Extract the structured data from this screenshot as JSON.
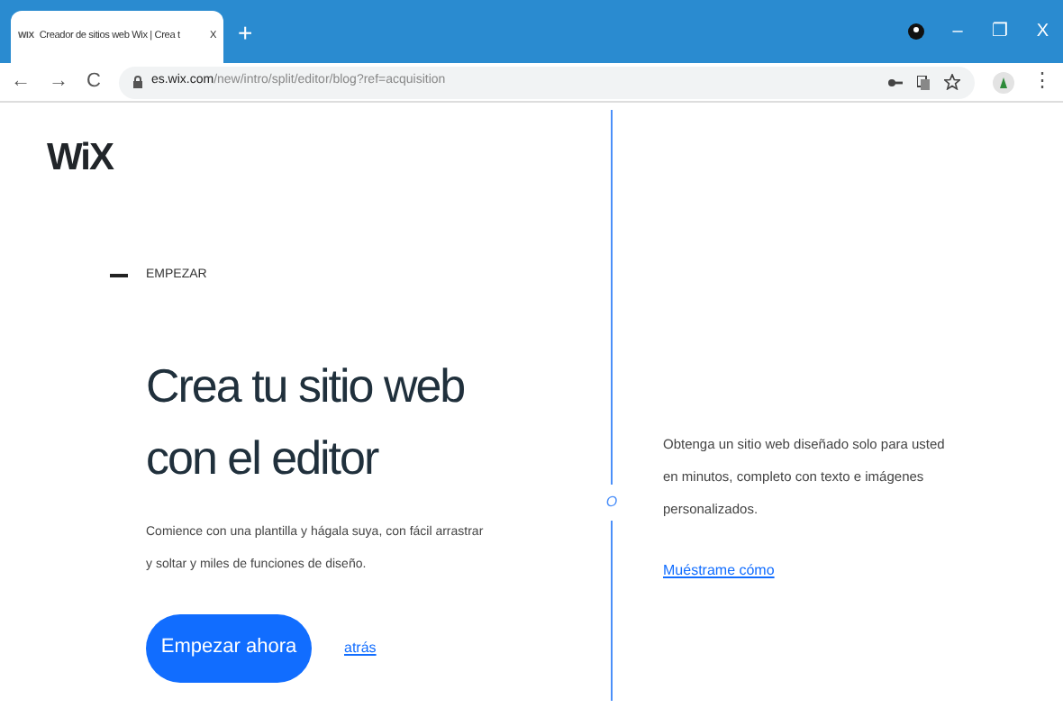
{
  "browser": {
    "tab": {
      "favicon": "WIX",
      "title": "Creador de sitios web Wix | Crea t",
      "close": "X",
      "selected": true
    },
    "new_tab": "+",
    "window_controls": [
      "–",
      "❐",
      "X"
    ],
    "nav_buttons": [
      "←",
      "→",
      "C"
    ],
    "menu": "⋮",
    "url_host": "es.wix.com",
    "url_path": "/new/intro/split/editor/blog?ref=acquisition"
  },
  "logo": "WiX",
  "eyebrow": "EMPEZAR",
  "heading": [
    "Crea tu sitio web",
    "con el editor"
  ],
  "description": "Comience con una plantilla y hágala suya, con fácil arrastrar y soltar y miles de funciones de diseño.",
  "primary_button": "Empezar ahora",
  "back_link": "atrás",
  "divider_label": "O",
  "alt_description": "Obtenga un sitio web diseñado solo para usted en minutos, completo con texto e imágenes personalizados.",
  "alt_link": "Muéstrame cómo"
}
